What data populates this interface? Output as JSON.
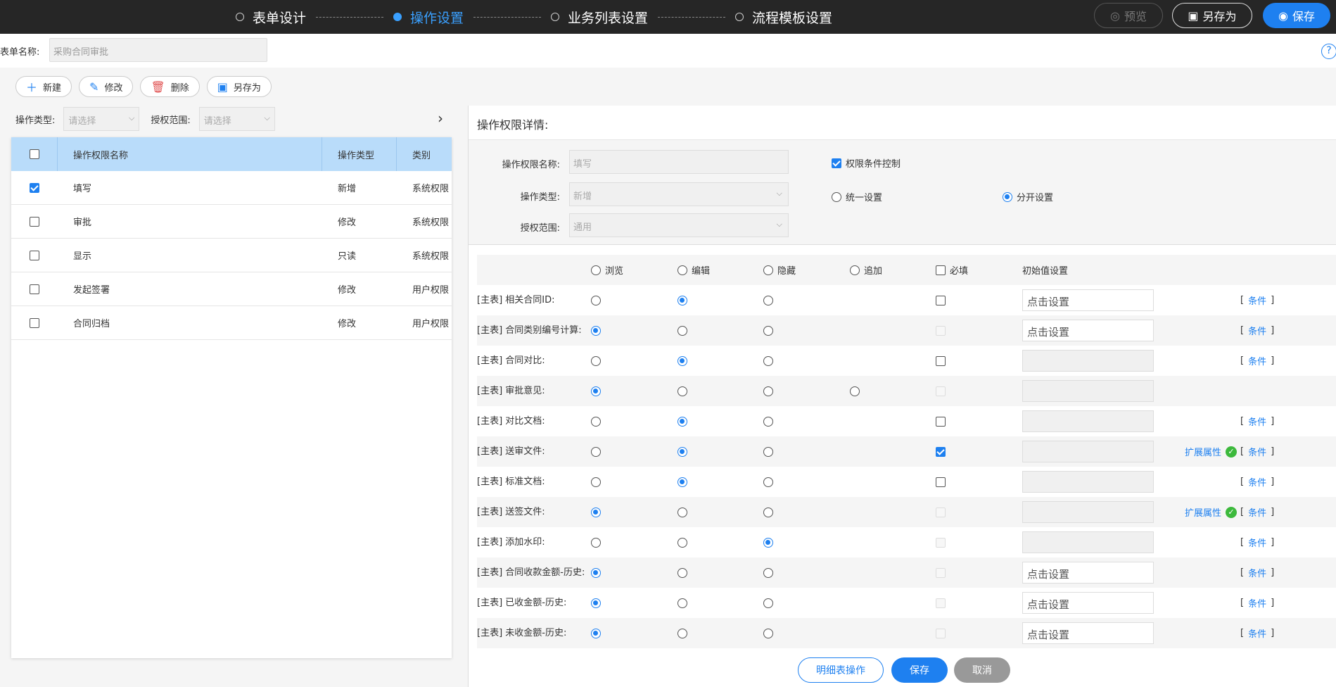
{
  "steps": [
    {
      "label": "表单设计",
      "active": false
    },
    {
      "label": "操作设置",
      "active": true
    },
    {
      "label": "业务列表设置",
      "active": false
    },
    {
      "label": "流程模板设置",
      "active": false
    }
  ],
  "top_buttons": {
    "preview": "预览",
    "save_as": "另存为",
    "save": "保存"
  },
  "form_name": {
    "label": "表单名称:",
    "value": "采购合同审批"
  },
  "toolbar": {
    "new": "新建",
    "edit": "修改",
    "delete": "删除",
    "save_as": "另存为"
  },
  "filters": {
    "op_type_label": "操作类型:",
    "op_type_placeholder": "请选择",
    "scope_label": "授权范围:",
    "scope_placeholder": "请选择"
  },
  "left_table": {
    "headers": {
      "name": "操作权限名称",
      "type": "操作类型",
      "category": "类别"
    },
    "rows": [
      {
        "name": "填写",
        "type": "新增",
        "category": "系统权限",
        "checked": true
      },
      {
        "name": "审批",
        "type": "修改",
        "category": "系统权限",
        "checked": false
      },
      {
        "name": "显示",
        "type": "只读",
        "category": "系统权限",
        "checked": false
      },
      {
        "name": "发起签署",
        "type": "修改",
        "category": "用户权限",
        "checked": false
      },
      {
        "name": "合同归档",
        "type": "修改",
        "category": "用户权限",
        "checked": false
      }
    ]
  },
  "detail": {
    "title": "操作权限详情:",
    "name_label": "操作权限名称:",
    "name_value": "填写",
    "type_label": "操作类型:",
    "type_value": "新增",
    "scope_label": "授权范围:",
    "scope_value": "通用",
    "cond_control": "权限条件控制",
    "unified": "统一设置",
    "separate": "分开设置"
  },
  "grid": {
    "headers": {
      "view": "浏览",
      "edit": "编辑",
      "hide": "隐藏",
      "append": "追加",
      "required": "必填",
      "init": "初始值设置"
    },
    "rows": [
      {
        "field": "[主表] 相关合同ID:",
        "mode": "edit",
        "append": false,
        "req": "off",
        "init": "点击设置",
        "ext": false,
        "cond": true
      },
      {
        "field": "[主表] 合同类别编号计算:",
        "mode": "view",
        "append": false,
        "req": "dis",
        "init": "点击设置",
        "ext": false,
        "cond": true
      },
      {
        "field": "[主表] 合同对比:",
        "mode": "edit",
        "append": false,
        "req": "off",
        "init": "",
        "ext": false,
        "cond": true
      },
      {
        "field": "[主表] 审批意见:",
        "mode": "view",
        "append": true,
        "req": "dis",
        "init": "",
        "ext": false,
        "cond": false
      },
      {
        "field": "[主表] 对比文档:",
        "mode": "edit",
        "append": false,
        "req": "off",
        "init": "",
        "ext": false,
        "cond": true
      },
      {
        "field": "[主表] 送审文件:",
        "mode": "edit",
        "append": false,
        "req": "on",
        "init": "",
        "ext": true,
        "cond": true
      },
      {
        "field": "[主表] 标准文档:",
        "mode": "edit",
        "append": false,
        "req": "off",
        "init": "",
        "ext": false,
        "cond": true
      },
      {
        "field": "[主表] 送签文件:",
        "mode": "view",
        "append": false,
        "req": "dis",
        "init": "",
        "ext": true,
        "cond": true
      },
      {
        "field": "[主表] 添加水印:",
        "mode": "hide",
        "append": false,
        "req": "dis",
        "init": "",
        "ext": false,
        "cond": true
      },
      {
        "field": "[主表] 合同收款金额-历史:",
        "mode": "view",
        "append": false,
        "req": "dis",
        "init": "点击设置",
        "ext": false,
        "cond": true
      },
      {
        "field": "[主表] 已收金额-历史:",
        "mode": "view",
        "append": false,
        "req": "dis",
        "init": "点击设置",
        "ext": false,
        "cond": true
      },
      {
        "field": "[主表] 未收金额-历史:",
        "mode": "view",
        "append": false,
        "req": "dis",
        "init": "点击设置",
        "ext": false,
        "cond": true
      }
    ],
    "ext_label": "扩展属性",
    "cond_label": "条件"
  },
  "bottom": {
    "detail_ops": "明细表操作",
    "save": "保存",
    "cancel": "取消"
  },
  "colors": {
    "accent": "#1e80f0",
    "topbar": "#262626",
    "header_row": "#b9dcfa",
    "ok": "#3cb93c"
  }
}
